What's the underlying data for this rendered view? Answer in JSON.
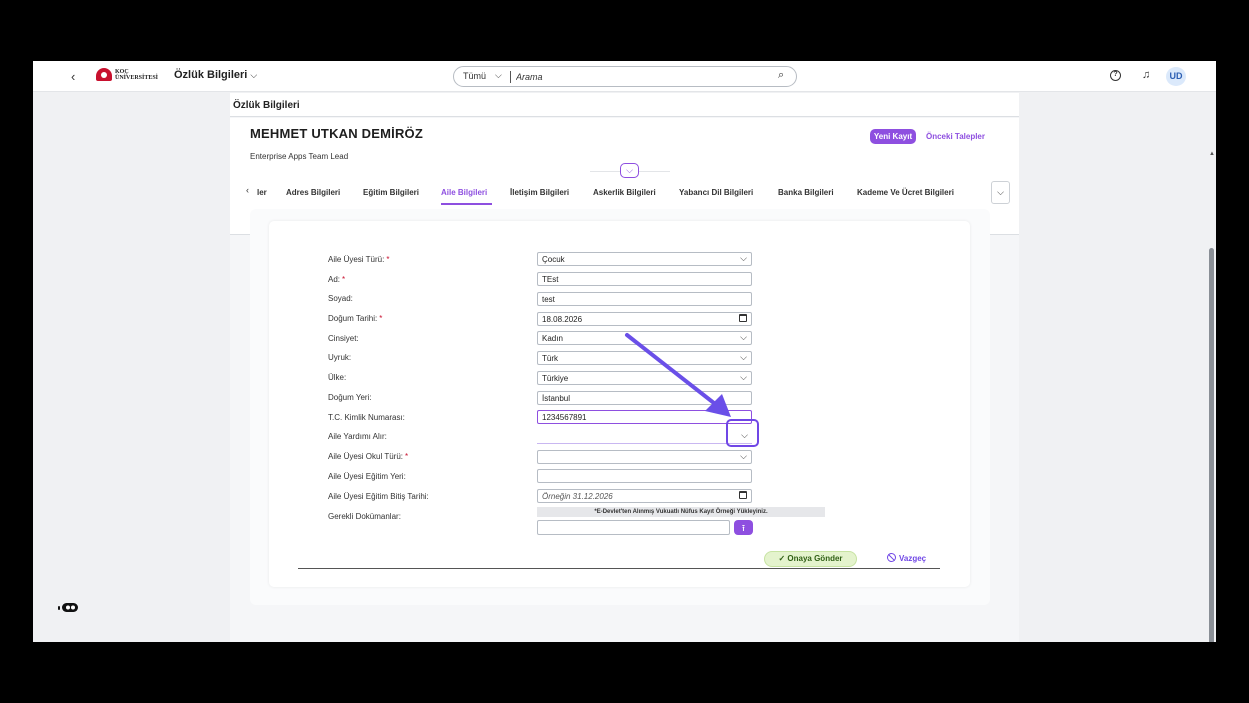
{
  "topbar": {
    "logo_text_1": "KOÇ",
    "logo_text_2": "ÜNİVERSİTESİ",
    "app_title": "Özlük Bilgileri",
    "search": {
      "scope": "Tümü",
      "placeholder": "Arama"
    },
    "avatar_initials": "UD"
  },
  "section_title": "Özlük Bilgileri",
  "person": {
    "name": "MEHMET UTKAN DEMİRÖZ",
    "role": "Enterprise Apps Team Lead"
  },
  "actions": {
    "new_record": "Yeni Kayıt",
    "previous_requests": "Önceki Talepler"
  },
  "tabs": [
    {
      "label": "ler"
    },
    {
      "label": "Adres Bilgileri"
    },
    {
      "label": "Eğitim Bilgileri"
    },
    {
      "label": "Aile Bilgileri"
    },
    {
      "label": "İletişim Bilgileri"
    },
    {
      "label": "Askerlik Bilgileri"
    },
    {
      "label": "Yabancı Dil Bilgileri"
    },
    {
      "label": "Banka Bilgileri"
    },
    {
      "label": "Kademe Ve Ücret Bilgileri"
    }
  ],
  "form": {
    "rows": [
      {
        "label": "Aile Üyesi Türü:",
        "value": "Çocuk"
      },
      {
        "label": "Ad:",
        "value": "TEst"
      },
      {
        "label": "Soyad:",
        "value": "test"
      },
      {
        "label": "Doğum Tarihi:",
        "value": "18.08.2026"
      },
      {
        "label": "Cinsiyet:",
        "value": "Kadın"
      },
      {
        "label": "Uyruk:",
        "value": "Türk"
      },
      {
        "label": "Ülke:",
        "value": "Türkiye"
      },
      {
        "label": "Doğum Yeri:",
        "value": "İstanbul"
      },
      {
        "label": "T.C. Kimlik Numarası:",
        "value": "1234567891"
      },
      {
        "label": "Aile Yardımı Alır:",
        "value": ""
      },
      {
        "label": "Aile Üyesi Okul Türü:",
        "value": ""
      },
      {
        "label": "Aile Üyesi Eğitim Yeri:",
        "value": ""
      },
      {
        "label": "Aile Üyesi Eğitim Bitiş Tarihi:",
        "value": "",
        "placeholder": "Örneğin 31.12.2026"
      },
      {
        "label": "Gerekli Dokümanlar:",
        "value": ""
      }
    ],
    "required_mark": "*",
    "notice": "*E-Devlet'ten Alınmış Vukuatlı Nüfus Kayıt Örneği Yükleyiniz.",
    "submit_label": "Onaya Gönder",
    "cancel_label": "Vazgeç"
  },
  "colors": {
    "accent": "#8e4fe0",
    "highlight": "#7047e6",
    "submit_bg": "#e4f3cd"
  }
}
